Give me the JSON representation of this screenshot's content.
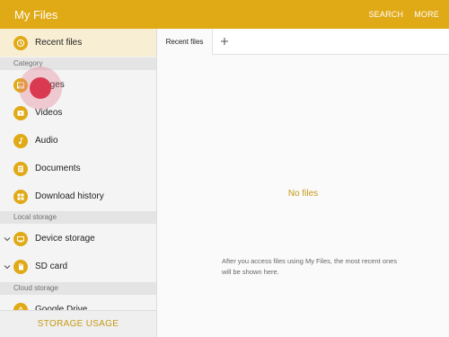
{
  "app": {
    "title": "My Files",
    "actions": {
      "search": "SEARCH",
      "more": "MORE"
    }
  },
  "sidebar": {
    "recent": {
      "label": "Recent files",
      "icon": "recent-clock-icon"
    },
    "sections": {
      "category": "Category",
      "local": "Local storage",
      "cloud": "Cloud storage"
    },
    "category_items": [
      {
        "label": "Images",
        "icon": "image-icon"
      },
      {
        "label": "Videos",
        "icon": "video-icon"
      },
      {
        "label": "Audio",
        "icon": "audio-icon"
      },
      {
        "label": "Documents",
        "icon": "document-icon"
      },
      {
        "label": "Download history",
        "icon": "download-icon"
      }
    ],
    "local_items": [
      {
        "label": "Device storage",
        "icon": "device-icon"
      },
      {
        "label": "SD card",
        "icon": "sd-card-icon"
      }
    ],
    "cloud_items": [
      {
        "label": "Google Drive",
        "icon": "google-drive-icon"
      }
    ],
    "storage_usage": "STORAGE USAGE"
  },
  "tabs": [
    {
      "label": "Recent files"
    }
  ],
  "main": {
    "empty_title": "No files",
    "empty_message": "After you access files using My Files, the most recent ones will be shown here."
  },
  "colors": {
    "accent": "#e0a916",
    "accent_text": "#c59a14",
    "touch": "#d93a52"
  }
}
